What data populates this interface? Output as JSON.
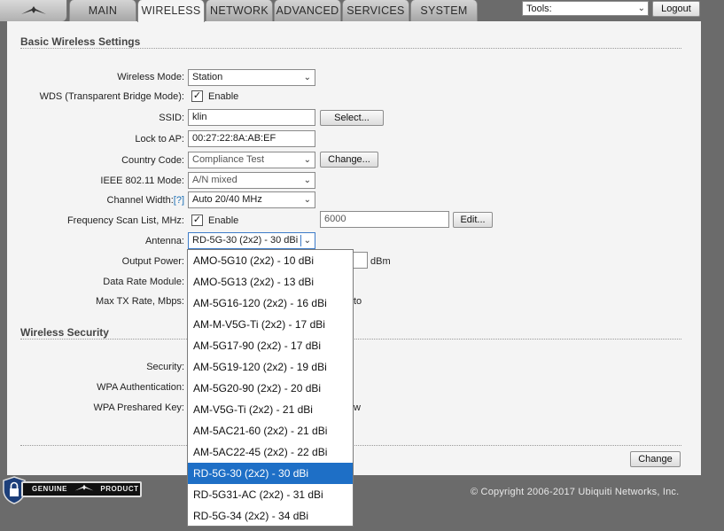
{
  "tabs": [
    {
      "label": "MAIN"
    },
    {
      "label": "WIRELESS"
    },
    {
      "label": "NETWORK"
    },
    {
      "label": "ADVANCED"
    },
    {
      "label": "SERVICES"
    },
    {
      "label": "SYSTEM"
    }
  ],
  "active_tab": "WIRELESS",
  "toolbar": {
    "tools_value": "Tools:",
    "logout_label": "Logout"
  },
  "basic": {
    "title": "Basic Wireless Settings",
    "wireless_mode": {
      "label": "Wireless Mode:",
      "value": "Station"
    },
    "wds": {
      "label": "WDS (Transparent Bridge Mode):",
      "checkbox": "Enable",
      "checked": true
    },
    "ssid": {
      "label": "SSID:",
      "value": "klin",
      "button": "Select..."
    },
    "lock_ap": {
      "label": "Lock to AP:",
      "value": "00:27:22:8A:AB:EF"
    },
    "country": {
      "label": "Country Code:",
      "value": "Compliance Test",
      "button": "Change..."
    },
    "ieee": {
      "label": "IEEE 802.11 Mode:",
      "value": "A/N mixed"
    },
    "channel_width": {
      "label": "Channel Width:",
      "help": "[?]",
      "value": "Auto 20/40 MHz"
    },
    "freq_scan": {
      "label": "Frequency Scan List, MHz:",
      "checkbox": "Enable",
      "checked": true,
      "value": "6000",
      "button": "Edit..."
    },
    "antenna": {
      "label": "Antenna:",
      "value": "RD-5G-30 (2x2) - 30 dBi"
    },
    "output_power": {
      "label": "Output Power:",
      "unit": "dBm"
    },
    "data_rate": {
      "label": "Data Rate Module:"
    },
    "max_tx": {
      "label": "Max TX Rate, Mbps:",
      "suffix_partial": "to"
    }
  },
  "security": {
    "title": "Wireless Security",
    "security_label": "Security:",
    "wpa_auth_label": "WPA Authentication:",
    "wpa_key_label": "WPA Preshared Key:",
    "key_suffix_partial": "w"
  },
  "antenna_options": [
    "AMO-5G10 (2x2) - 10 dBi",
    "AMO-5G13 (2x2) - 13 dBi",
    "AM-5G16-120 (2x2) - 16 dBi",
    "AM-M-V5G-Ti (2x2) - 17 dBi",
    "AM-5G17-90 (2x2) - 17 dBi",
    "AM-5G19-120 (2x2) - 19 dBi",
    "AM-5G20-90 (2x2) - 20 dBi",
    "AM-V5G-Ti (2x2) - 21 dBi",
    "AM-5AC21-60 (2x2) - 21 dBi",
    "AM-5AC22-45 (2x2) - 22 dBi",
    "RD-5G-30 (2x2) - 30 dBi",
    "RD-5G31-AC (2x2) - 31 dBi",
    "RD-5G-34 (2x2) - 34 dBi"
  ],
  "selected_option_index": 10,
  "change_button": "Change",
  "footer": {
    "copyright": "© Copyright 2006-2017 Ubiquiti Networks, Inc.",
    "genuine_badge": "GENUINE",
    "genuine_badge_2": "PRODUCT"
  },
  "colors": {
    "selected_option_bg": "#1e6fc6",
    "help_link": "#1b6fb5"
  }
}
